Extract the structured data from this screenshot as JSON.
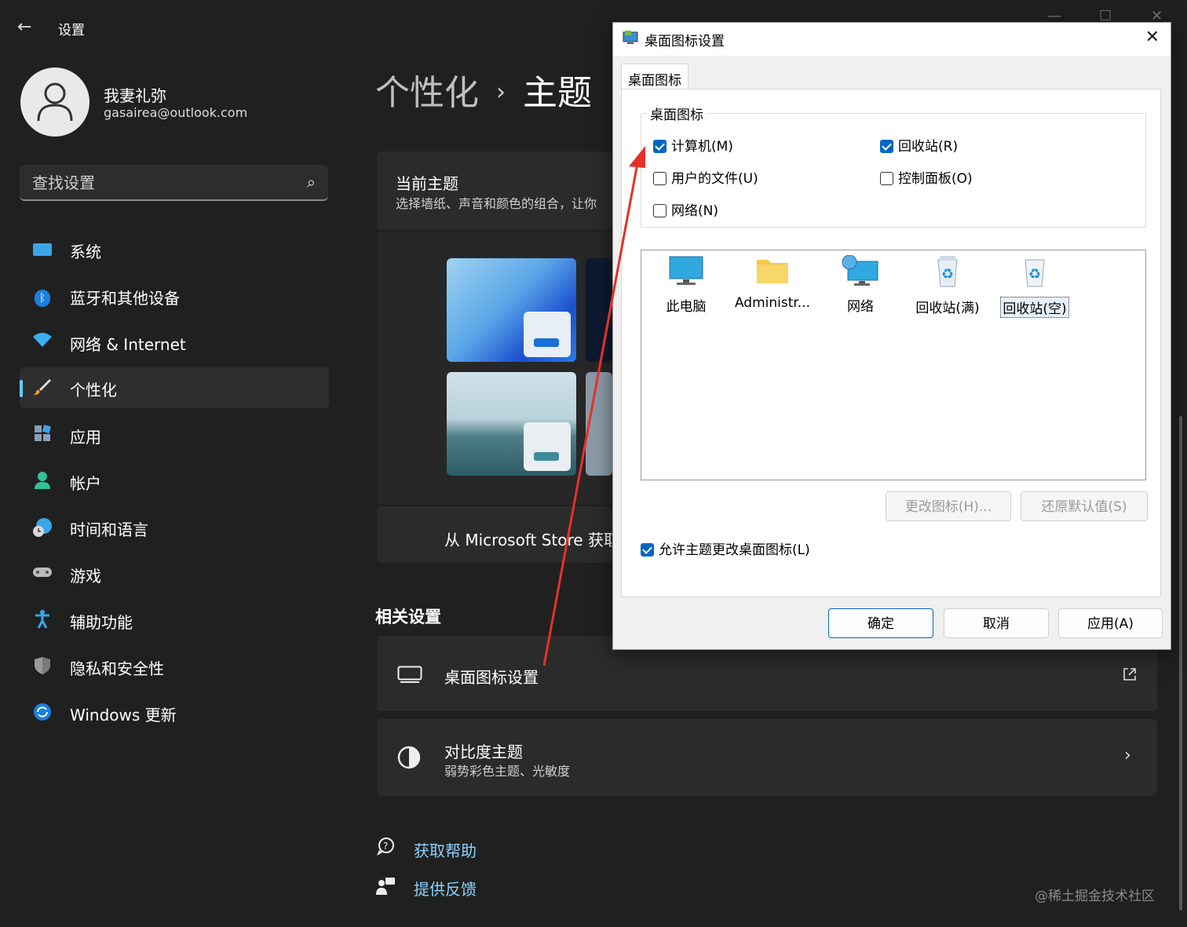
{
  "window": {
    "title": "设置"
  },
  "profile": {
    "name": "我妻礼弥",
    "email": "gasairea@outlook.com"
  },
  "search": {
    "placeholder": "查找设置"
  },
  "nav": [
    {
      "label": "系统",
      "icon": "monitor-icon",
      "selected": false
    },
    {
      "label": "蓝牙和其他设备",
      "icon": "bluetooth-icon",
      "selected": false
    },
    {
      "label": "网络 & Internet",
      "icon": "wifi-icon",
      "selected": false
    },
    {
      "label": "个性化",
      "icon": "brush-icon",
      "selected": true
    },
    {
      "label": "应用",
      "icon": "apps-icon",
      "selected": false
    },
    {
      "label": "帐户",
      "icon": "person-icon",
      "selected": false
    },
    {
      "label": "时间和语言",
      "icon": "globe-clock-icon",
      "selected": false
    },
    {
      "label": "游戏",
      "icon": "gamepad-icon",
      "selected": false
    },
    {
      "label": "辅助功能",
      "icon": "accessibility-icon",
      "selected": false
    },
    {
      "label": "隐私和安全性",
      "icon": "shield-icon",
      "selected": false
    },
    {
      "label": "Windows 更新",
      "icon": "update-icon",
      "selected": false
    }
  ],
  "breadcrumb": {
    "parent": "个性化",
    "separator": "›",
    "current": "主题"
  },
  "current_theme": {
    "title": "当前主题",
    "subtitle": "选择墙纸、声音和颜色的组合，让你"
  },
  "store": {
    "text": "从 Microsoft Store 获取更多主题"
  },
  "related": {
    "heading": "相关设置",
    "desktop_icons": {
      "label": "桌面图标设置",
      "icon": "desktop-icon",
      "action_icon": "open-external-icon"
    },
    "contrast": {
      "label": "对比度主题",
      "sub": "弱势彩色主题、光敏度",
      "icon": "contrast-icon",
      "action_icon": "chevron-right-icon"
    }
  },
  "help": {
    "get_help": "获取帮助",
    "feedback": "提供反馈"
  },
  "watermark": "@稀土掘金技术社区",
  "dialog": {
    "title": "桌面图标设置",
    "close": "✕",
    "tab": "桌面图标",
    "group_label": "桌面图标",
    "checkboxes": [
      {
        "label": "计算机(M)",
        "checked": true
      },
      {
        "label": "回收站(R)",
        "checked": true
      },
      {
        "label": "用户的文件(U)",
        "checked": false
      },
      {
        "label": "控制面板(O)",
        "checked": false
      },
      {
        "label": "网络(N)",
        "checked": false
      }
    ],
    "icons": [
      {
        "label": "此电脑",
        "icon": "this-pc-icon"
      },
      {
        "label": "Administr...",
        "icon": "user-folder-icon"
      },
      {
        "label": "网络",
        "icon": "network-icon"
      },
      {
        "label": "回收站(满)",
        "icon": "recycle-bin-full-icon"
      },
      {
        "label": "回收站(空)",
        "icon": "recycle-bin-empty-icon"
      }
    ],
    "change_icon": "更改图标(H)...",
    "restore_default": "还原默认值(S)",
    "allow_themes": {
      "label": "允许主题更改桌面图标(L)",
      "checked": true
    },
    "ok": "确定",
    "cancel": "取消",
    "apply": "应用(A)"
  },
  "colors": {
    "accent": "#60cdff",
    "dialog_accent": "#0067c0",
    "arrow": "#e8302a"
  }
}
